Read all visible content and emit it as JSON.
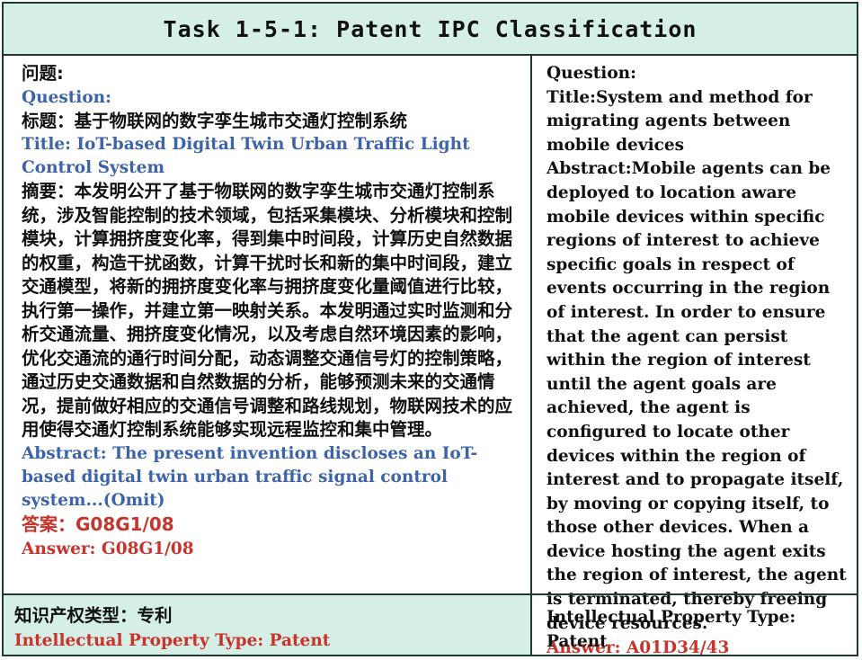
{
  "header": {
    "title": "Task 1-5-1:  Patent IPC Classification"
  },
  "left": {
    "question_cn": "问题:",
    "question_en": "Question:",
    "title_cn": "标题：基于物联网的数字孪生城市交通灯控制系统",
    "title_en": "Title: IoT-based Digital Twin Urban Traffic Light Control System",
    "abstract_cn": "摘要：本发明公开了基于物联网的数字孪生城市交通灯控制系统，涉及智能控制的技术领域，包括采集模块、分析模块和控制模块，计算拥挤度变化率，得到集中时间段，计算历史自然数据的权重，构造干扰函数，计算干扰时长和新的集中时间段，建立交通模型，将新的拥挤度变化率与拥挤度变化量阈值进行比较，执行第一操作，并建立第一映射关系。本发明通过实时监测和分析交通流量、拥挤度变化情况，以及考虑自然环境因素的影响，优化交通流的通行时间分配，动态调整交通信号灯的控制策略，通过历史交通数据和自然数据的分析，能够预测未来的交通情况，提前做好相应的交通信号调整和路线规划，物联网技术的应用使得交通灯控制系统能够实现远程监控和集中管理。",
    "abstract_en": "Abstract: The present invention discloses an IoT-based digital twin urban traffic signal control system...(Omit)",
    "answer_cn": "答案：G08G1/08",
    "answer_en": "Answer:  G08G1/08"
  },
  "right": {
    "question": "Question:",
    "title": "Title:System and method for migrating agents between mobile devices",
    "abstract": "Abstract:Mobile agents can be deployed to location aware mobile devices within specific regions of interest to achieve specific goals in respect of events occurring in the region of interest. In order to ensure that the agent can persist within the region of interest until the agent goals are achieved, the agent is configured to locate other devices within the region of interest and to propagate itself, by moving or copying itself, to those other devices. When a device hosting the agent exits the region of interest, the agent is terminated, thereby freeing device resources.",
    "answer": "Answer:  A01D34/43"
  },
  "footer": {
    "ip_type_cn": "知识产权类型：专利",
    "ip_type_en": "Intellectual Property Type: Patent",
    "ip_type_right": "Intellectual Property Type: Patent"
  },
  "colors": {
    "header_bg": "#d5eee6",
    "border": "#1f3a36",
    "blue_text": "#3d63a8",
    "red_text": "#c8332b"
  }
}
